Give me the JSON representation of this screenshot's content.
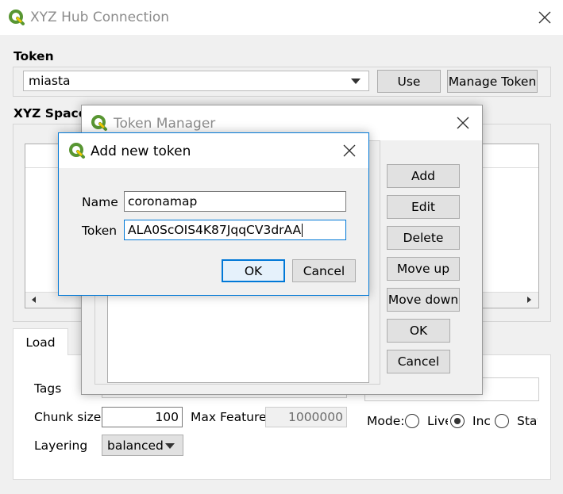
{
  "main_window": {
    "title": "XYZ Hub Connection",
    "token_section": "Token",
    "token_selected": "miasta",
    "use_button": "Use",
    "manage_token_button": "Manage Token",
    "space_section": "XYZ Space",
    "load_tab": "Load",
    "tags_label": "Tags",
    "chunk_size_label": "Chunk size",
    "chunk_size_value": "100",
    "max_feature_label": "Max Feature",
    "max_feature_value": "1000000",
    "layering_label": "Layering",
    "layering_value": "balanced",
    "mode_label": "Mode:",
    "mode_options": [
      {
        "label": "Live",
        "checked": false
      },
      {
        "label": "Inc",
        "checked": true
      },
      {
        "label": "Stat",
        "checked": false
      }
    ]
  },
  "token_manager": {
    "title": "Token Manager",
    "buttons": {
      "add": "Add",
      "edit": "Edit",
      "delete": "Delete",
      "move_up": "Move up",
      "move_down": "Move down",
      "ok": "OK",
      "cancel": "Cancel"
    }
  },
  "add_token_dialog": {
    "title": "Add new token",
    "name_label": "Name",
    "name_value": "coronamap",
    "token_label": "Token",
    "token_value": "ALA0ScOIS4K87JqqCV3drAA",
    "ok_button": "OK",
    "cancel_button": "Cancel"
  },
  "colors": {
    "accent": "#0078d7",
    "qgis_green": "#589632",
    "qgis_yellow": "#ee7913"
  }
}
